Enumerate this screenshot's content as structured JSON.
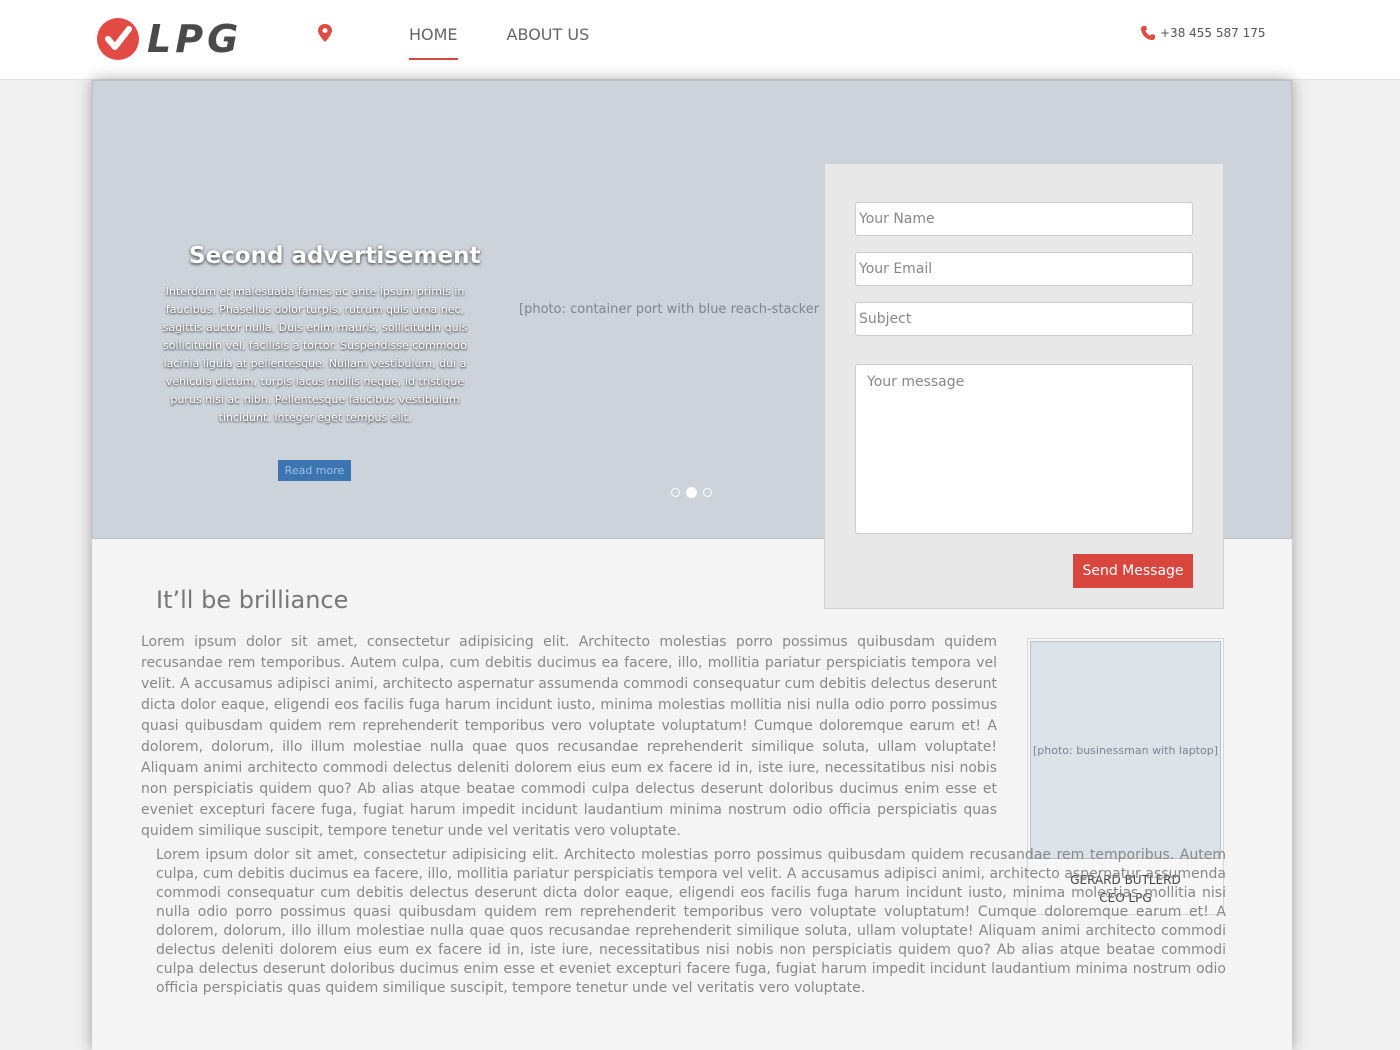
{
  "header": {
    "logo_text": "LPG",
    "nav": [
      {
        "label": "HOME",
        "active": true
      },
      {
        "label": "ABOUT US",
        "active": false
      }
    ],
    "phone": "+38 455 587 175"
  },
  "hero": {
    "image_label": "[photo: container port with blue reach-stacker crane]",
    "slide_title": "Second advertisement",
    "slide_text": "Interdum et malesuada fames ac ante ipsum primis in faucibus. Phasellus dolor turpis, rutrum quis urna nec, sagittis auctor nulla. Duis enim mauris, sollicitudin quis sollicitudin vel, facilisis a tortor. Suspendisse commodo lacinia ligula at pellentesque. Nullam vestibulum, dui a vehicula dictum, turpis lacus mollis neque, id tristique purus nisi ac nibh. Pellentesque faucibus vestibulum tincidunt. Integer eget tempus elit.",
    "read_more": "Read more",
    "slides_count": 3,
    "active_slide": 2
  },
  "contact_form": {
    "name_placeholder": "Your Name",
    "email_placeholder": "Your Email",
    "subject_placeholder": "Subject",
    "message_placeholder": "Your message",
    "send_label": "Send Message"
  },
  "article": {
    "heading": "It’ll be brilliance",
    "para1": "Lorem ipsum dolor sit amet, consectetur adipisicing elit. Architecto molestias porro possimus quibusdam quidem recusandae rem temporibus. Autem culpa, cum debitis ducimus ea facere, illo, mollitia pariatur perspiciatis tempora vel velit. A accusamus adipisci animi, architecto aspernatur assumenda commodi consequatur cum debitis delectus deserunt dicta dolor eaque, eligendi eos facilis fuga harum incidunt iusto, minima molestias mollitia nisi nulla odio porro possimus quasi quibusdam quidem rem reprehenderit temporibus vero voluptate voluptatum! Cumque doloremque earum et! A dolorem, dolorum, illo illum molestiae nulla quae quos recusandae reprehenderit similique soluta, ullam voluptate! Aliquam animi architecto commodi delectus deleniti dolorem eius eum ex facere id in, iste iure, necessitatibus nisi nobis non perspiciatis quidem quo? Ab alias atque beatae commodi culpa delectus deserunt doloribus ducimus enim esse et eveniet excepturi facere fuga, fugiat harum impedit incidunt laudantium minima nostrum odio officia perspiciatis quas quidem similique suscipit, tempore tenetur unde vel veritatis vero voluptate.",
    "para2": "Lorem ipsum dolor sit amet, consectetur adipisicing elit. Architecto molestias porro possimus quibusdam quidem recusandae rem temporibus. Autem culpa, cum debitis ducimus ea facere, illo, mollitia pariatur perspiciatis tempora vel velit. A accusamus adipisci animi, architecto aspernatur assumenda commodi consequatur cum debitis delectus deserunt dicta dolor eaque, eligendi eos facilis fuga harum incidunt iusto, minima molestias mollitia nisi nulla odio porro possimus quasi quibusdam quidem rem reprehenderit temporibus vero voluptate voluptatum! Cumque doloremque earum et! A dolorem, dolorum, illo illum molestiae nulla quae quos recusandae reprehenderit similique soluta, ullam voluptate! Aliquam animi architecto commodi delectus deleniti dolorem eius eum ex facere id in, iste iure, necessitatibus nisi nobis non perspiciatis quidem quo? Ab alias atque beatae commodi culpa delectus deserunt doloribus ducimus enim esse et eveniet excepturi facere fuga, fugiat harum impedit incidunt laudantium minima nostrum odio officia perspiciatis quas quidem similique suscipit, tempore tenetur unde vel veritatis vero voluptate."
  },
  "profile": {
    "photo_label": "[photo: businessman with laptop]",
    "name": "GERARD BUTLERD",
    "title": "CEO LPG"
  },
  "colors": {
    "accent": "#d9463e",
    "button_blue": "#3c75b0"
  }
}
